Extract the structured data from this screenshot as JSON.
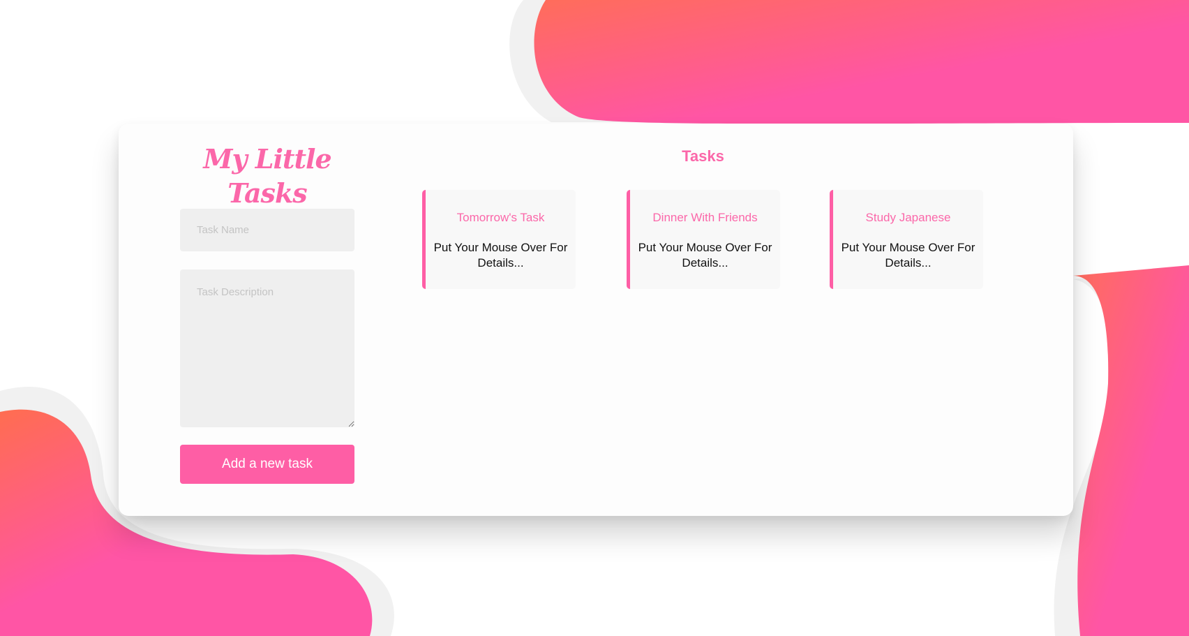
{
  "app": {
    "title": "My Little Tasks"
  },
  "form": {
    "task_name_placeholder": "Task Name",
    "task_description_placeholder": "Task Description",
    "add_button_label": "Add a new task"
  },
  "tasks_section": {
    "heading": "Tasks",
    "hint": "Put Your Mouse Over For Details...",
    "items": [
      {
        "name": "Tomorrow's Task"
      },
      {
        "name": "Dinner With Friends"
      },
      {
        "name": "Study Japanese"
      }
    ]
  },
  "colors": {
    "accent": "#fe5ea5",
    "accent_text": "#fb67a9",
    "blob_gradient_start": "#ff6d5a",
    "blob_gradient_end": "#ff55a5",
    "input_background": "#efefef",
    "task_card_background": "#f8f8f8",
    "card_background": "#fdfdfd"
  }
}
